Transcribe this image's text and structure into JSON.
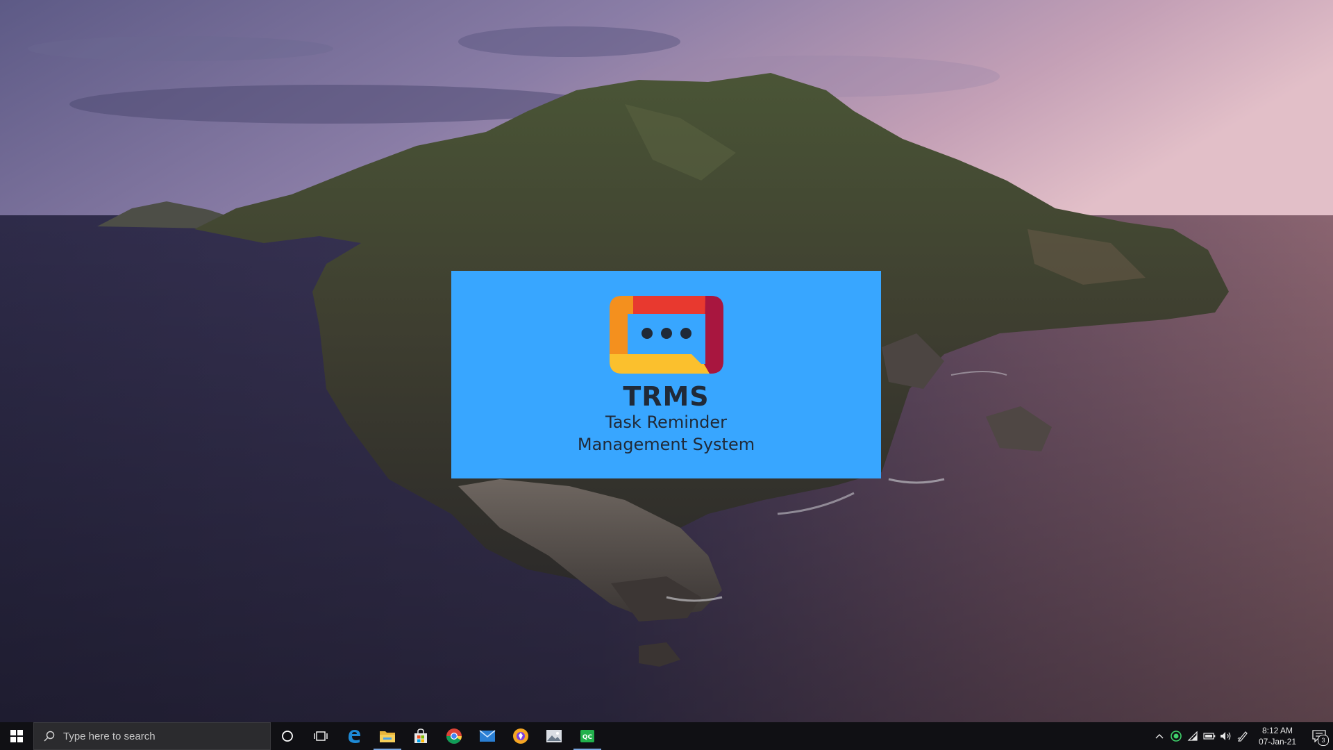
{
  "splash": {
    "title": "TRMS",
    "subtitle_line1": "Task Reminder",
    "subtitle_line2": "Management System",
    "background": "#38a6ff",
    "logo_colors": [
      "#e8392f",
      "#f4901e",
      "#fbc02d",
      "#a8163f"
    ]
  },
  "taskbar": {
    "search_placeholder": "Type here to search",
    "pinned": [
      {
        "name": "cortana-icon"
      },
      {
        "name": "task-view-icon"
      },
      {
        "name": "edge-icon"
      },
      {
        "name": "file-explorer-icon",
        "active": true
      },
      {
        "name": "store-icon"
      },
      {
        "name": "chrome-icon"
      },
      {
        "name": "mail-icon"
      },
      {
        "name": "brave-icon"
      },
      {
        "name": "photos-icon"
      },
      {
        "name": "qc-app-icon",
        "active": true
      }
    ],
    "tray": {
      "time": "8:12 AM",
      "date": "07-Jan-21",
      "notification_count": "3"
    }
  }
}
